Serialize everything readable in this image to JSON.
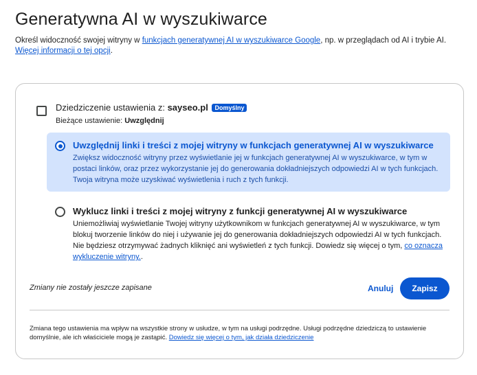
{
  "page": {
    "title": "Generatywna AI w wyszukiwarce",
    "intro_prefix": "Określ widoczność swojej witryny w ",
    "intro_link": "funkcjach generatywnej AI w wyszukiwarce Google",
    "intro_suffix": ", np. w przeglądach od AI i trybie AI.",
    "more_info_link": "Więcej informacji o tej opcji",
    "more_info_suffix": "."
  },
  "inherit": {
    "label_prefix": "Dziedziczenie ustawienia z: ",
    "site": "sayseo.pl",
    "badge": "Domyślny",
    "current_prefix": "Bieżące ustawienie: ",
    "current_value": "Uwzględnij",
    "checked": false
  },
  "options": [
    {
      "title": "Uwzględnij linki i treści z mojej witryny w funkcjach generatywnej AI w wyszukiwarce",
      "description": "Zwiększ widoczność witryny przez wyświetlanie jej w funkcjach generatywnej AI w wyszukiwarce, w tym w postaci linków, oraz przez wykorzystanie jej do generowania dokładniejszych odpowiedzi AI w tych funkcjach. Twoja witryna może uzyskiwać wyświetlenia i ruch z tych funkcji.",
      "selected": true
    },
    {
      "title": "Wyklucz linki i treści z mojej witryny z funkcji generatywnej AI w wyszukiwarce",
      "description": "Uniemożliwiaj wyświetlanie Twojej witryny użytkownikom w funkcjach generatywnej AI w wyszukiwarce, w tym blokuj tworzenie linków do niej i używanie jej do generowania dokładniejszych odpowiedzi AI w tych funkcjach. Nie będziesz otrzymywać żadnych kliknięć ani wyświetleń z tych funkcji. Dowiedz się więcej o tym, ",
      "link": "co oznacza wykluczenie witryny.",
      "link_suffix": ".",
      "selected": false
    }
  ],
  "actions": {
    "unsaved": "Zmiany nie zostały jeszcze zapisane",
    "cancel": "Anuluj",
    "save": "Zapisz"
  },
  "footer": {
    "text": "Zmiana tego ustawienia ma wpływ na wszystkie strony w usłudze, w tym na usługi podrzędne. Usługi podrzędne dziedziczą to ustawienie domyślnie, ale ich właściciele mogą je zastąpić. ",
    "link": "Dowiedz się więcej o tym, jak działa dziedziczenie"
  },
  "colors": {
    "accent": "#0b57d0",
    "selected_bg": "#d3e3fd"
  }
}
